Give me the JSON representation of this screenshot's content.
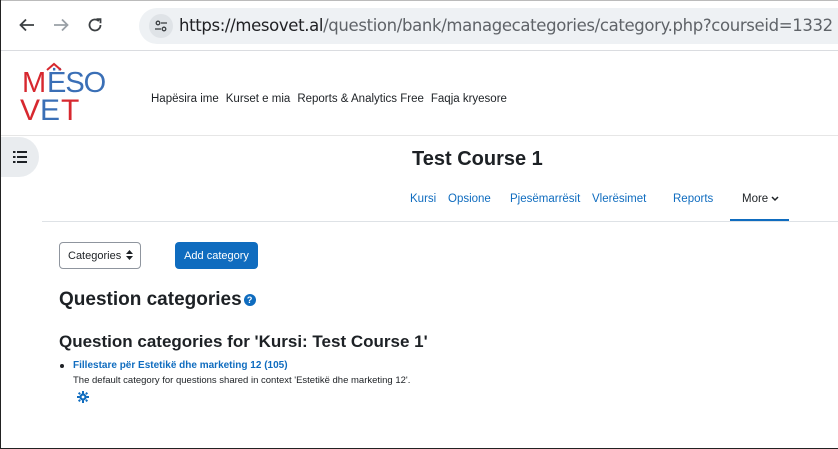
{
  "browser": {
    "url_domain": "https://mesovet.al",
    "url_path": "/question/bank/managecategories/category.php?courseid=1332",
    "icons": {
      "back": "back-arrow-icon",
      "forward": "forward-arrow-icon",
      "reload": "reload-icon",
      "site_info": "tune-icon"
    }
  },
  "site": {
    "logo_line1": "MËSO",
    "logo_line2": "VET",
    "nav": [
      "Hapësira ime",
      "Kurset e mia",
      "Reports & Analytics Free",
      "Faqja kryesore"
    ]
  },
  "course": {
    "title": "Test Course 1",
    "nav": [
      {
        "label": "Kursi"
      },
      {
        "label": "Opsione"
      },
      {
        "label": "Pjesëmarrësit"
      },
      {
        "label": "Vlerësimet"
      },
      {
        "label": "Reports"
      },
      {
        "label": "More",
        "active": true
      }
    ]
  },
  "actions": {
    "select_value": "Categories",
    "add_button": "Add category"
  },
  "page": {
    "heading": "Question categories",
    "subheading": "Question categories for 'Kursi: Test Course 1'",
    "categories": [
      {
        "name": "Fillestare për Estetikë dhe marketing 12 (105)",
        "description": "The default category for questions shared in context 'Estetikë dhe marketing 12'."
      }
    ]
  },
  "colors": {
    "accent": "#0f6cbf",
    "logo_red": "#d7282f",
    "logo_blue": "#3a6fb6"
  }
}
